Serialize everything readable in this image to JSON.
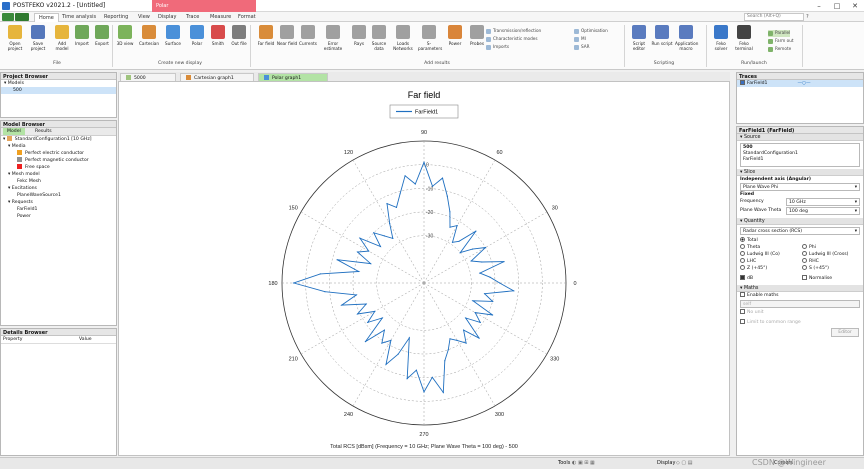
{
  "window": {
    "title": "POSTFEKO v2021.2 - [Untitled]",
    "contextual_tab": "Polar"
  },
  "ribbon_tabs": [
    "Home",
    "Time analysis",
    "Reporting",
    "View",
    "Display",
    "Trace",
    "Measure",
    "Format"
  ],
  "search_placeholder": "Search (Alt+Q)",
  "ribbon": {
    "buttons": [
      {
        "label": "Open project",
        "icon": "folder-icon",
        "color": "#e6b53c"
      },
      {
        "label": "Save project",
        "icon": "save-icon",
        "color": "#5577bb"
      },
      {
        "label": "Add model",
        "icon": "add-model-icon",
        "color": "#e6b53c"
      },
      {
        "label": "Import",
        "icon": "import-icon",
        "color": "#6fa85a"
      },
      {
        "label": "Export",
        "icon": "export-icon",
        "color": "#6fa85a"
      },
      {
        "label": "3D view",
        "icon": "cube-icon",
        "color": "#7cb35b"
      },
      {
        "label": "Cartesian",
        "icon": "cartesian-icon",
        "color": "#d98c3a"
      },
      {
        "label": "Surface",
        "icon": "surface-icon",
        "color": "#4a90d9"
      },
      {
        "label": "Polar",
        "icon": "polar-icon",
        "color": "#4a90d9"
      },
      {
        "label": "Smith",
        "icon": "smith-icon",
        "color": "#d84b4b"
      },
      {
        "label": "Out file",
        "icon": "outfile-icon",
        "color": "#7d7d7d"
      },
      {
        "label": "Far field",
        "icon": "farfield-icon",
        "color": "#d98c3a"
      },
      {
        "label": "Near field",
        "icon": "nearfield-icon",
        "color": "#a0a0a0"
      },
      {
        "label": "Currents",
        "icon": "currents-icon",
        "color": "#a0a0a0"
      },
      {
        "label": "Error estimate",
        "icon": "error-icon",
        "color": "#a0a0a0"
      },
      {
        "label": "Rays",
        "icon": "rays-icon",
        "color": "#a0a0a0"
      },
      {
        "label": "Source data",
        "icon": "source-icon",
        "color": "#a0a0a0"
      },
      {
        "label": "Loads Networks",
        "icon": "loads-icon",
        "color": "#a0a0a0"
      },
      {
        "label": "S-parameters",
        "icon": "sparam-icon",
        "color": "#a0a0a0"
      },
      {
        "label": "Power",
        "icon": "power-icon",
        "color": "#d9853a"
      },
      {
        "label": "Probes",
        "icon": "probe-icon",
        "color": "#a0a0a0"
      },
      {
        "label": "Script editor",
        "icon": "script-icon",
        "color": "#5a7bbf"
      },
      {
        "label": "Run script",
        "icon": "run-script-icon",
        "color": "#5a7bbf"
      },
      {
        "label": "Application macro",
        "icon": "macro-icon",
        "color": "#5a7bbf"
      },
      {
        "label": "Feko solver",
        "icon": "solver-icon",
        "color": "#3a78c9"
      },
      {
        "label": "Feko terminal",
        "icon": "terminal-icon",
        "color": "#444444"
      }
    ],
    "small_items": [
      {
        "label": "Transmission/reflection",
        "icon": "transmission-icon"
      },
      {
        "label": "Characteristic modes",
        "icon": "modes-icon"
      },
      {
        "label": "Imports",
        "icon": "imports-icon"
      },
      {
        "label": "Optimisation",
        "icon": "optimisation-icon"
      },
      {
        "label": "MI",
        "icon": "mi-icon"
      },
      {
        "label": "SAR",
        "icon": "sar-icon"
      }
    ],
    "run_items": [
      {
        "label": "Parallel",
        "active": true
      },
      {
        "label": "Farm out",
        "active": false
      },
      {
        "label": "Remote",
        "active": false
      }
    ],
    "groups": [
      "File",
      "Create new display",
      "Add results",
      "Scripting",
      "Run/launch"
    ]
  },
  "project_browser": {
    "title": "Project Browser",
    "models_label": "Models",
    "selected_model": "500"
  },
  "model_browser": {
    "title": "Model Browser",
    "tabs": [
      "Model",
      "Results"
    ],
    "config": "StandardConfiguration1 [10 GHz]",
    "sections": [
      {
        "label": "Media",
        "items": [
          {
            "label": "Perfect electric conductor",
            "color": "#f0a020"
          },
          {
            "label": "Perfect magnetic conductor",
            "color": "#909090"
          },
          {
            "label": "Free space",
            "color": "#ee2020"
          }
        ]
      },
      {
        "label": "Mesh model",
        "items": [
          {
            "label": "Fekc Mesh",
            "color": null
          }
        ]
      },
      {
        "label": "Excitations",
        "items": [
          {
            "label": "PlaneWaveSource1",
            "color": null
          }
        ]
      },
      {
        "label": "Requests",
        "items": [
          {
            "label": "FarField1",
            "color": null
          },
          {
            "label": "Power",
            "color": null
          }
        ]
      }
    ]
  },
  "details_browser": {
    "title": "Details Browser",
    "columns": [
      "Property",
      "Value"
    ]
  },
  "doc_tabs": [
    "5000",
    "Cartesian graph1",
    "Polar graph1"
  ],
  "plot": {
    "title": "Far field",
    "caption": "Total RCS [dBsm] (Frequency = 10 GHz; Plane Wave Theta = 100 deg) - 500"
  },
  "chart_data": {
    "type": "line",
    "polar": true,
    "title": "Far field",
    "xlabel": "",
    "ylabel": "",
    "theta_unit": "deg",
    "radial_ticks": [
      0,
      -10,
      -20,
      -30
    ],
    "radial_range": [
      -50,
      10
    ],
    "angle_ticks": [
      0,
      30,
      60,
      90,
      120,
      150,
      180,
      210,
      240,
      270,
      300,
      330
    ],
    "grid": true,
    "legend_position": "top-center",
    "series": [
      {
        "name": "FarField1",
        "color": "#1f6fc0",
        "theta": [
          0,
          5,
          10,
          15,
          20,
          25,
          30,
          35,
          40,
          45,
          50,
          55,
          60,
          65,
          70,
          75,
          80,
          85,
          90,
          95,
          100,
          105,
          110,
          115,
          120,
          125,
          130,
          135,
          140,
          145,
          150,
          155,
          160,
          165,
          170,
          175,
          180,
          185,
          190,
          195,
          200,
          205,
          210,
          215,
          220,
          225,
          230,
          235,
          240,
          245,
          250,
          255,
          260,
          265,
          270,
          275,
          280,
          285,
          290,
          295,
          300,
          305,
          310,
          315,
          320,
          325,
          330,
          335,
          340,
          345,
          350,
          355
        ],
        "r": [
          -18,
          -22,
          -26,
          -15,
          -24,
          -28,
          -20,
          -25,
          -30,
          -19,
          -27,
          -29,
          -22,
          -24,
          -18,
          -12,
          -5,
          -9,
          1,
          -8,
          -4,
          -11,
          -16,
          -13,
          -21,
          -27,
          -24,
          -20,
          -26,
          -17,
          -23,
          -19,
          -26,
          -12,
          -22,
          -6,
          5,
          -8,
          -21,
          -14,
          -24,
          -19,
          -26,
          -21,
          -27,
          -15,
          -24,
          -19,
          -22,
          -12,
          -18,
          -26,
          -9,
          -13,
          -4,
          -10,
          -3,
          -16,
          -20,
          -24,
          -22,
          -19,
          -24,
          -17,
          -27,
          -21,
          -25,
          -18,
          -28,
          -20,
          -24,
          -12
        ]
      }
    ]
  },
  "traces": {
    "title": "Traces",
    "items": [
      "FarField1"
    ]
  },
  "properties": {
    "title": "FarField1 (FarField)",
    "source_head": "Source",
    "source_lines": [
      "500",
      "StandardConfiguration1",
      "FarField1"
    ],
    "slice_head": "Slice",
    "independent_axis_label": "Independent axis (Angular)",
    "independent_axis_value": "Plane Wave Phi",
    "fixed_label": "Fixed",
    "fixed_rows": [
      {
        "label": "Frequency",
        "value": "10 GHz"
      },
      {
        "label": "Plane Wave Theta",
        "value": "100 deg"
      }
    ],
    "quantity_head": "Quantity",
    "quantity_value": "Radar cross section (RCS)",
    "radio_options": [
      {
        "label": "Total",
        "on": true
      },
      {
        "label": "Phi",
        "on": false
      },
      {
        "label": "Theta",
        "on": false
      },
      {
        "label": "Ludwig III (Cross)",
        "on": false
      },
      {
        "label": "Ludwig III (Co)",
        "on": false
      },
      {
        "label": "RHC",
        "on": false
      },
      {
        "label": "LHC",
        "on": false
      },
      {
        "label": "S (+45°)",
        "on": false
      },
      {
        "label": "Z (+45°)",
        "on": false
      }
    ],
    "db_label": "dB",
    "normalise_label": "Normalise",
    "maths_head": "Maths",
    "enable_maths_label": "Enable maths",
    "maths_placeholder": "self",
    "no_unit_label": "No unit",
    "limit_label": "Limit to common range",
    "editor_button": "Editor"
  },
  "statusbar": {
    "tools_label": "Tools",
    "display_label": "Display",
    "cursors_label": "Cursors",
    "watermark": "CSDN @Wingineer"
  }
}
